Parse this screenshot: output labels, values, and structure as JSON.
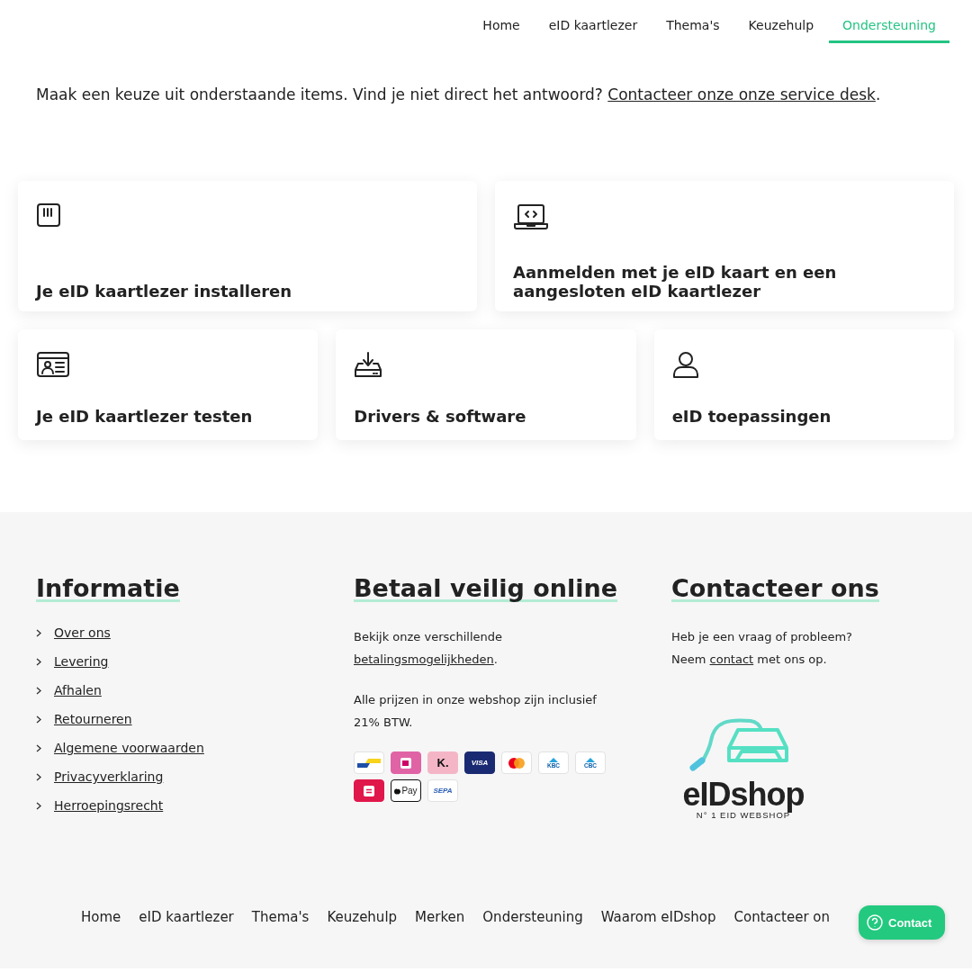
{
  "nav": [
    {
      "label": "Home",
      "selected": false
    },
    {
      "label": "eID kaartlezer",
      "selected": false
    },
    {
      "label": "Thema's",
      "selected": false
    },
    {
      "label": "Keuzehulp",
      "selected": false
    },
    {
      "label": "Ondersteuning",
      "selected": true
    }
  ],
  "intro": {
    "text": "Maak een keuze uit onderstaande items. Vind je niet direct het antwoord? ",
    "link": "Contacteer onze onze service desk",
    "end": "."
  },
  "cards": [
    {
      "kind": "reader",
      "title": "Je eID kaartlezer installeren"
    },
    {
      "kind": "laptop",
      "title": "Aanmelden met je eID kaart en een aangesloten eID kaartlezer"
    },
    {
      "kind": "idcard",
      "title": "Je eID kaartlezer testen"
    },
    {
      "kind": "download",
      "title": "Drivers & software"
    },
    {
      "kind": "user",
      "title": "eID toepassingen"
    }
  ],
  "footer": {
    "info": {
      "title": "Informatie",
      "links": [
        "Over ons",
        "Levering",
        "Afhalen",
        "Retourneren",
        "Algemene voorwaarden",
        "Privacyverklaring",
        "Herroepingsrecht"
      ]
    },
    "payment": {
      "title": "Betaal veilig online",
      "text": "Bekijk onze verschillende ",
      "link": "betalingsmogelijkheden",
      "end": ".",
      "note": "Alle prijzen in onze webshop zijn inclusief 21% BTW.",
      "methods": [
        {
          "kind": "bancontact"
        },
        {
          "kind": "ideal"
        },
        {
          "kind": "klarna",
          "label": "K."
        },
        {
          "kind": "visa",
          "label": "VISA"
        },
        {
          "kind": "mastercard"
        },
        {
          "kind": "kbc",
          "label": "KBC"
        },
        {
          "kind": "cbc",
          "label": "CBC"
        },
        {
          "kind": "payconiq"
        },
        {
          "kind": "applepay",
          "label": "Pay"
        },
        {
          "kind": "sepa",
          "label": "SEPA"
        }
      ]
    },
    "contact": {
      "title": "Contacteer ons",
      "line": "Heb je een vraag of probleem?",
      "text": "Neem ",
      "link": "contact",
      "end": " met ons op.",
      "logo": {
        "name": "eIDshop",
        "tagline": "N° 1 EID WEBSHOP"
      }
    }
  },
  "bottom_nav": [
    "Home",
    "eID kaartlezer",
    "Thema's",
    "Keuzehulp",
    "Merken",
    "Ondersteuning",
    "Waarom eIDshop",
    "Contacteer on"
  ],
  "contact_button": {
    "label": "Contact"
  }
}
